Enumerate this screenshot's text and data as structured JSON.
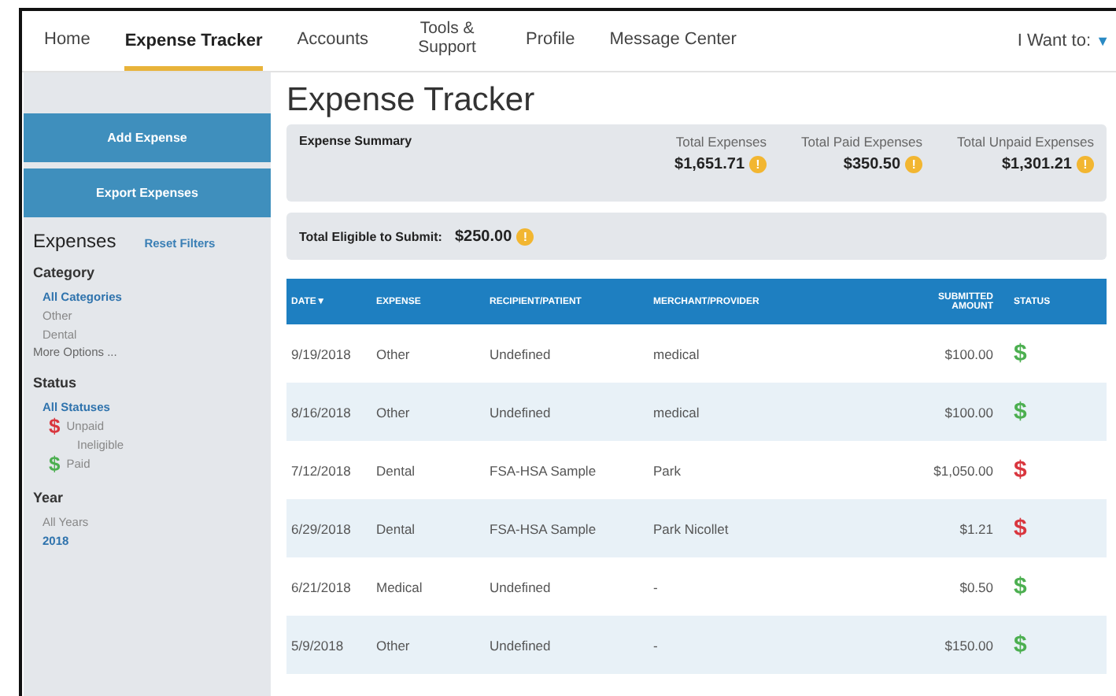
{
  "nav": {
    "tabs": [
      {
        "label": "Home",
        "selected": false
      },
      {
        "label": "Expense Tracker",
        "selected": true
      },
      {
        "label": "Accounts",
        "selected": false
      },
      {
        "label": "Tools & Support",
        "selected": false
      },
      {
        "label": "Profile",
        "selected": false
      },
      {
        "label": "Message Center",
        "selected": false
      }
    ],
    "menu": {
      "label": "I Want to:",
      "caret": "▼"
    }
  },
  "sidebar": {
    "buttons": [
      "Add Expense",
      "Export Expenses"
    ],
    "heading": "Expenses",
    "reset": "Reset Filters",
    "groups": [
      {
        "title": "Category",
        "items": [
          {
            "label": "All Categories",
            "selected": true
          },
          {
            "label": "Other",
            "selected": false
          },
          {
            "label": "Dental",
            "selected": false
          }
        ],
        "more": "More Options ..."
      },
      {
        "title": "Status",
        "items": [
          {
            "label": "All Statuses",
            "selected": true
          },
          {
            "label": "Unpaid",
            "selected": false,
            "icon": "$",
            "color": "#d9363e"
          },
          {
            "label": "Ineligible",
            "selected": false
          },
          {
            "label": "Paid",
            "selected": false,
            "icon": "$",
            "color": "#4caf50"
          }
        ]
      },
      {
        "title": "Year",
        "items": [
          {
            "label": "All Years",
            "selected": false
          },
          {
            "label": "2018",
            "selected": true
          }
        ]
      }
    ]
  },
  "main": {
    "title": "Expense Tracker",
    "summary": {
      "heading": "Expense Summary",
      "totals": [
        {
          "label": "Total Expenses",
          "value": "$1,651.71"
        },
        {
          "label": "Total Paid Expenses",
          "value": "$350.50"
        },
        {
          "label": "Total Unpaid Expenses",
          "value": "$1,301.21"
        }
      ],
      "info_icon": "!"
    },
    "eligible": {
      "label": "Total Eligible to Submit:",
      "value": "$250.00"
    },
    "table": {
      "columns": [
        "DATE",
        "EXPENSE",
        "RECIPIENT/PATIENT",
        "MERCHANT/PROVIDER",
        "SUBMITTED AMOUNT",
        "STATUS"
      ],
      "sort_caret": "▼",
      "rows": [
        {
          "date": "9/19/2018",
          "expense": "Other",
          "recipient": "Undefined",
          "merchant": "medical",
          "amount": "$100.00",
          "status": "$",
          "color": "#4caf50"
        },
        {
          "date": "8/16/2018",
          "expense": "Other",
          "recipient": "Undefined",
          "merchant": "medical",
          "amount": "$100.00",
          "status": "$",
          "color": "#4caf50"
        },
        {
          "date": "7/12/2018",
          "expense": "Dental",
          "recipient": "FSA-HSA Sample",
          "merchant": "Park",
          "amount": "$1,050.00",
          "status": "$",
          "color": "#d9363e"
        },
        {
          "date": "6/29/2018",
          "expense": "Dental",
          "recipient": "FSA-HSA Sample",
          "merchant": "Park Nicollet",
          "amount": "$1.21",
          "status": "$",
          "color": "#d9363e"
        },
        {
          "date": "6/21/2018",
          "expense": "Medical",
          "recipient": "Undefined",
          "merchant": "-",
          "amount": "$0.50",
          "status": "$",
          "color": "#4caf50"
        },
        {
          "date": "5/9/2018",
          "expense": "Other",
          "recipient": "Undefined",
          "merchant": "-",
          "amount": "$150.00",
          "status": "$",
          "color": "#4caf50"
        }
      ]
    }
  }
}
